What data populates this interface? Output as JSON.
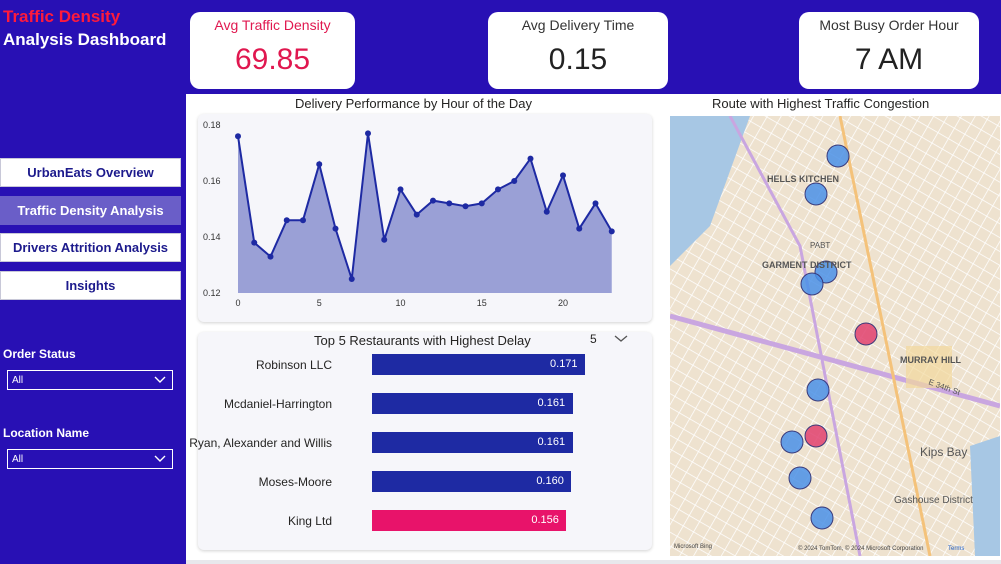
{
  "sidebar": {
    "title_line1": "Traffic Density",
    "title_line2": "Analysis Dashboard",
    "nav": [
      {
        "label": "UrbanEats Overview",
        "active": false
      },
      {
        "label": "Traffic Density Analysis",
        "active": true
      },
      {
        "label": "Drivers Attrition Analysis",
        "active": false
      },
      {
        "label": "Insights",
        "active": false
      }
    ],
    "order_status": {
      "label": "Order Status",
      "value": "All"
    },
    "location_name": {
      "label": "Location Name",
      "value": "All"
    }
  },
  "kpis": [
    {
      "label": "Avg Traffic Density",
      "value": "69.85",
      "accent": "#e0174f"
    },
    {
      "label": "Avg Delivery Time",
      "value": "0.15",
      "accent": "#252423"
    },
    {
      "label": "Most Busy Order Hour",
      "value": "7 AM",
      "accent": "#252423"
    }
  ],
  "chart_data": [
    {
      "type": "area",
      "title": "Delivery Performance by Hour of the Day",
      "x": [
        0,
        1,
        2,
        3,
        4,
        5,
        6,
        7,
        8,
        9,
        10,
        11,
        12,
        13,
        14,
        15,
        16,
        17,
        18,
        19,
        20,
        21,
        22,
        23
      ],
      "values": [
        0.176,
        0.138,
        0.133,
        0.146,
        0.146,
        0.166,
        0.143,
        0.125,
        0.177,
        0.139,
        0.157,
        0.148,
        0.153,
        0.152,
        0.151,
        0.152,
        0.157,
        0.16,
        0.168,
        0.149,
        0.162,
        0.143,
        0.152,
        0.142
      ],
      "xticks": [
        0,
        5,
        10,
        15,
        20
      ],
      "yticks": [
        "0.12",
        "0.14",
        "0.16",
        "0.18"
      ],
      "ylim": [
        0.12,
        0.18
      ],
      "xlim": [
        0,
        24
      ],
      "color": "#1e2aa3",
      "fill": "#9aa0d6"
    },
    {
      "type": "bar",
      "title": "Top 5 Restaurants with Highest Delay",
      "categories": [
        "Robinson LLC",
        "Mcdaniel-Harrington",
        "Ryan, Alexander and Willis",
        "Moses-Moore",
        "King Ltd"
      ],
      "values": [
        0.171,
        0.161,
        0.161,
        0.16,
        0.156
      ],
      "labels": [
        "0.171",
        "0.161",
        "0.161",
        "0.160",
        "0.156"
      ],
      "colors": [
        "#1e2aa3",
        "#1e2aa3",
        "#1e2aa3",
        "#1e2aa3",
        "#e8136a"
      ],
      "xlim": [
        0,
        0.175
      ]
    }
  ],
  "top_n": {
    "value": "5"
  },
  "map": {
    "title": "Route with Highest Traffic Congestion",
    "labels": [
      "HELLS KITCHEN",
      "GARMENT DISTRICT",
      "PABT",
      "MURRAY HILL",
      "Kips Bay",
      "Gashouse District",
      "E 34th St"
    ],
    "attribution": "© 2024 TomTom, © 2024 Microsoft Corporation",
    "terms": "Terms",
    "bing": "Microsoft Bing",
    "markers": [
      {
        "color": "#4a90e8"
      },
      {
        "color": "#4a90e8"
      },
      {
        "color": "#4a90e8"
      },
      {
        "color": "#4a90e8"
      },
      {
        "color": "#e0416f"
      },
      {
        "color": "#4a90e8"
      },
      {
        "color": "#4a90e8"
      },
      {
        "color": "#e0416f"
      },
      {
        "color": "#4a90e8"
      },
      {
        "color": "#4a90e8"
      }
    ]
  }
}
